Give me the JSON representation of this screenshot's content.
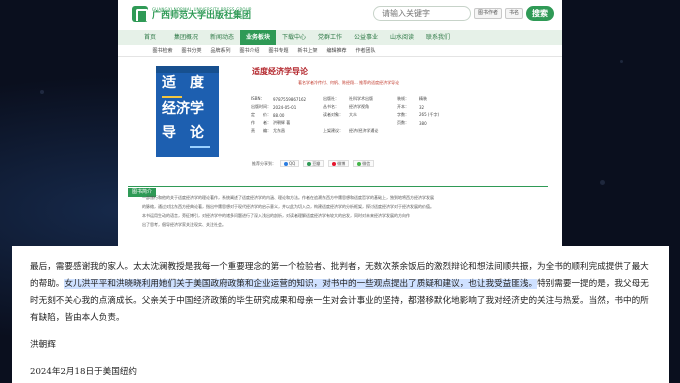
{
  "site": {
    "logo_en": "GUANGXI NORMAL UNIVERSITY PRESS GROUP",
    "logo_cn": "广西师范大学出版社集团",
    "search_placeholder": "请输入关键字",
    "search_opt_1": "图书作者",
    "search_opt_2": "书名",
    "search_button": "搜索",
    "nav": [
      "首页",
      "集团概况",
      "新闻动态",
      "业务板块",
      "下载中心",
      "党群工作",
      "公益事业",
      "山水阅读",
      "联系我们"
    ],
    "subnav": [
      "图书检索",
      "图书分类",
      "品牌系列",
      "图书介绍",
      "图书专题",
      "新书上架",
      "编辑推荐",
      "作者团队"
    ],
    "book_title": "适度经济学导论",
    "book_subtitle": "著名学者冷传付、何帆、陈经翔... 推荐的适度经济学导论",
    "details": [
      [
        "ISBN：",
        "9787559867162",
        "出版社：",
        "社科学术出版",
        "装帧：",
        "精装"
      ],
      [
        "出版时间：",
        "2024-05-01",
        "丛书名：",
        "经济学视角",
        "开本：",
        "32"
      ],
      [
        "定　　价：",
        "88.00",
        "读者对象：",
        "大众",
        "字数：",
        "265 (千字)"
      ],
      [
        "作　　者：",
        "洪朝辉 著",
        "",
        "",
        "页数：",
        "380"
      ],
      [
        "责　　编：",
        "尤东昌",
        "上架建议：",
        "经济/经济学通论",
        "",
        ""
      ]
    ],
    "share_label": "推荐分享到：",
    "share_btns": [
      "QQ",
      "豆瓣",
      "微博",
      "微信"
    ],
    "section_title": "图书简介",
    "intro": [
      "一部旅行和他的关于适度经济学的理论著作，系统阐述了适度经济学的内涵、理论和方法。作者在追溯东西方中庸思想和适度哲学的基础上，独到地将西方经济学发展",
      "的脉络，通过对比东西方经典论著，指出中庸思想对于现代经济学的启示意义，并以此为切入点，构建适度经济学的分析框架，探讨适度经济学对于经济发展的价值。",
      "本书运用生动的语言，旁征博引，对经济学中的诸多问题进行了深入浅出的剖析，对读者理解适度经济学有较大的启发，同时对未来经济学发展的方向作",
      "出了思考，倡导经济学家关注现实、关注社会。"
    ]
  },
  "cover": {
    "title_chars": [
      "适",
      "度",
      "经济学",
      "导",
      "论"
    ]
  },
  "document": {
    "para_1a": "最后，需要感谢我的家人。太太沈澜教授是我每一个重要理念的第一个检验者、批判者，无数次茶余饭后的激烈辩论和想法间顺共振，为全书的顺利完成提供了最大的帮助。",
    "para_1b_hl": "女儿洪平平和洪晓晓利用她们关于美国政府政策和企业运营的知识，对书中的一些观点提出了质疑和建议，也让我受益匪浅。",
    "para_1c": "特别需要一提的是，我父母无时无刻不关心我的点滴成长。父亲关于中国经济政策的毕生研究成果和母亲一生对会计事业的坚持，都潜移默化地影响了我对经济史的关注与热爱。当然，书中的所有缺陷，皆由本人负责。",
    "signature": "洪朝辉",
    "date": "2024年2月18日于美国纽约"
  }
}
